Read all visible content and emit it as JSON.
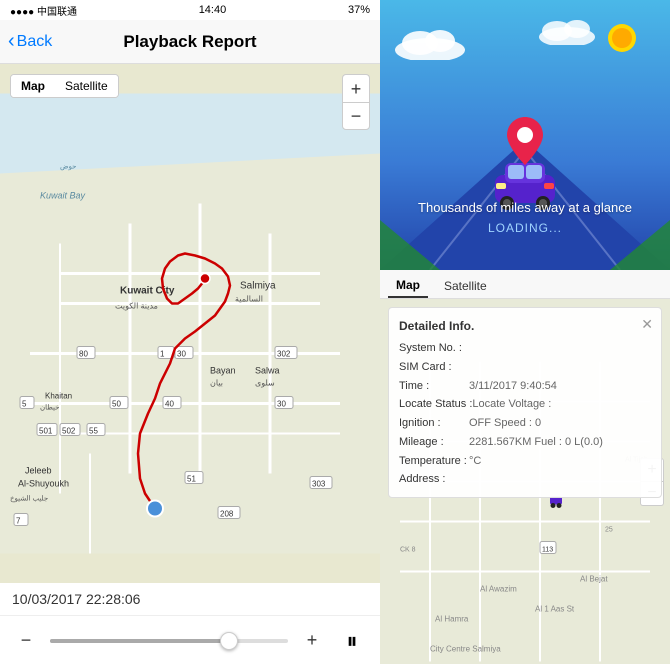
{
  "statusBar": {
    "time": "14:40",
    "signal": "●●●●",
    "battery": "37%"
  },
  "header": {
    "backLabel": "Back",
    "title": "Playback Report"
  },
  "mapToggle": {
    "mapLabel": "Map",
    "satelliteLabel": "Satellite"
  },
  "zoom": {
    "plusLabel": "+",
    "minusLabel": "−"
  },
  "timestamp": "10/03/2017 22:28:06",
  "controls": {
    "minusLabel": "−",
    "plusLabel": "+",
    "pauseLabel": "⏸"
  },
  "illustration": {
    "tagline": "Thousands of miles away at a glance",
    "loading": "LOADING..."
  },
  "infoMapToggle": {
    "mapLabel": "Map",
    "satelliteLabel": "Satellite"
  },
  "detailCard": {
    "title": "Detailed Info.",
    "closeLabel": "✕",
    "fields": [
      {
        "key": "System No. :",
        "value": ""
      },
      {
        "key": "SIM Card :",
        "value": ""
      },
      {
        "key": "Time :",
        "value": "3/11/2017 9:40:54"
      },
      {
        "key": "Locate Status :",
        "value": "Locate Voltage :"
      },
      {
        "key": "Ignition :",
        "value": "OFF Speed : 0"
      },
      {
        "key": "Mileage :",
        "value": "2281.567KM Fuel : 0 L(0.0)"
      },
      {
        "key": "Temperature :",
        "value": "°C"
      },
      {
        "key": "Address :",
        "value": ""
      }
    ]
  }
}
